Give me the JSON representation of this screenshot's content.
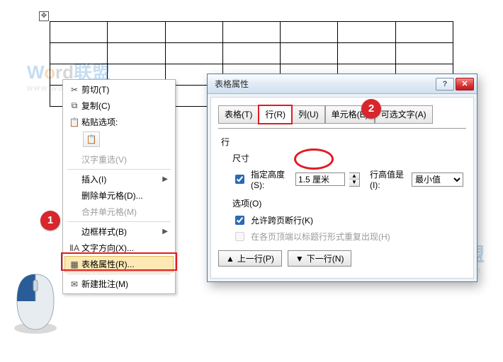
{
  "watermark": {
    "text_prefix": "W",
    "text_o": "o",
    "text_rd": "rd",
    "text_cn": "联盟",
    "sub": "www.wordlm.com"
  },
  "badges": {
    "one": "1",
    "two": "2"
  },
  "table": {
    "move_handle": "✥",
    "rows": 4,
    "cols": 7
  },
  "menu": {
    "cut": {
      "label": "剪切(T)",
      "icon": "✂"
    },
    "copy": {
      "label": "复制(C)",
      "icon": "⧉"
    },
    "paste_hdr": {
      "label": "粘贴选项:",
      "icon": "📋"
    },
    "paste_btn": {
      "icon": "📋"
    },
    "reconv": {
      "label": "汉字重选(V)"
    },
    "insert": {
      "label": "插入(I)"
    },
    "delcell": {
      "label": "删除单元格(D)..."
    },
    "merge": {
      "label": "合并单元格(M)"
    },
    "border": {
      "label": "边框样式(B)"
    },
    "textdir": {
      "label": "文字方向(X)...",
      "icon": "ⅡA"
    },
    "props": {
      "label": "表格属性(R)...",
      "icon": "▦"
    },
    "comment": {
      "label": "新建批注(M)",
      "icon": "✉"
    }
  },
  "dialog": {
    "title": "表格属性",
    "help": "?",
    "close": "✕",
    "tabs": {
      "table": "表格(T)",
      "row": "行(R)",
      "col": "列(U)",
      "cell": "单元格(E)",
      "alt": "可选文字(A)"
    },
    "row_section": "行",
    "size_section": "尺寸",
    "specify_height_label": "指定高度(S):",
    "height_value": "1.5 厘米",
    "height_is_label": "行高值是(I):",
    "height_is_value": "最小值",
    "options_section": "选项(O)",
    "allow_break_label": "允许跨页断行(K)",
    "allow_break_checked": true,
    "repeat_header_label": "在各页顶端以标题行形式重复出现(H)",
    "repeat_header_checked": false,
    "prev_row": "上一行(P)",
    "next_row": "下一行(N)",
    "prev_arrow": "▲",
    "next_arrow": "▼"
  }
}
